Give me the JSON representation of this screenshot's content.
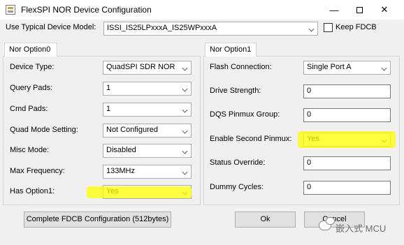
{
  "window": {
    "title": "FlexSPI NOR Device Configuration",
    "minimize_glyph": "—",
    "close_glyph": "✕"
  },
  "top": {
    "model_label": "Use Typical Device Model:",
    "model_value": "ISSI_IS25LPxxxA_IS25WPxxxA",
    "keep_fdcb_label": "Keep FDCB",
    "keep_fdcb_checked": false
  },
  "option0": {
    "tab": "Nor Option0",
    "fields": [
      {
        "label": "Device Type:",
        "value": "QuadSPI SDR NOR"
      },
      {
        "label": "Query Pads:",
        "value": "1"
      },
      {
        "label": "Cmd Pads:",
        "value": "1"
      },
      {
        "label": "Quad Mode Setting:",
        "value": "Not Configured"
      },
      {
        "label": "Misc Mode:",
        "value": "Disabled"
      },
      {
        "label": "Max Frequency:",
        "value": "133MHz"
      },
      {
        "label": "Has Option1:",
        "value": "Yes"
      }
    ]
  },
  "option1": {
    "tab": "Nor Option1",
    "fields": [
      {
        "label": "Flash Connection:",
        "value": "Single Port A",
        "kind": "select"
      },
      {
        "label": "Drive Strength:",
        "value": "0",
        "kind": "input"
      },
      {
        "label": "DQS Pinmux Group:",
        "value": "0",
        "kind": "input"
      },
      {
        "label": "Enable Second Pinmux:",
        "value": "Yes",
        "kind": "select"
      },
      {
        "label": "Status Override:",
        "value": "0",
        "kind": "input"
      },
      {
        "label": "Dummy Cycles:",
        "value": "0",
        "kind": "input"
      }
    ]
  },
  "buttons": {
    "complete": "Complete FDCB Configuration (512bytes)",
    "ok": "Ok",
    "cancel": "Cancel"
  },
  "watermark": {
    "text": "嵌入式 MCU"
  },
  "colors": {
    "highlight": "#ffff00",
    "title_bar": "#ffffff",
    "dialog": "#f0f0f0"
  }
}
